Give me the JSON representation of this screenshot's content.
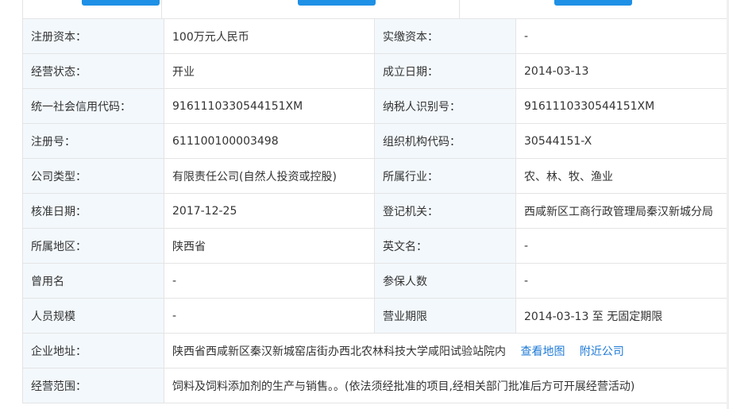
{
  "colors": {
    "label_bg": "#f3f8fc",
    "border": "#e4e4e4",
    "button": "#1e90e6",
    "link": "#1e7ad6"
  },
  "rows": [
    {
      "l1": "注册资本：",
      "v1": "100万元人民币",
      "l2": "实缴资本：",
      "v2": "-"
    },
    {
      "l1": "经营状态：",
      "v1": "开业",
      "l2": "成立日期：",
      "v2": "2014-03-13"
    },
    {
      "l1": "统一社会信用代码：",
      "v1": "9161110330544151XM",
      "l2": "纳税人识别号：",
      "v2": "9161110330544151XM"
    },
    {
      "l1": "注册号：",
      "v1": "611100100003498",
      "l2": "组织机构代码：",
      "v2": "30544151-X"
    },
    {
      "l1": "公司类型：",
      "v1": "有限责任公司(自然人投资或控股)",
      "l2": "所属行业：",
      "v2": "农、林、牧、渔业"
    },
    {
      "l1": "核准日期：",
      "v1": "2017-12-25",
      "l2": "登记机关：",
      "v2": "西咸新区工商行政管理局秦汉新城分局"
    },
    {
      "l1": "所属地区：",
      "v1": "陕西省",
      "l2": "英文名：",
      "v2": "-"
    },
    {
      "l1": "曾用名",
      "v1": "-",
      "l2": "参保人数",
      "v2": "-"
    },
    {
      "l1": "人员规模",
      "v1": "-",
      "l2": "营业期限",
      "v2": "2014-03-13 至 无固定期限"
    }
  ],
  "address": {
    "label": "企业地址：",
    "value": "陕西省西咸新区秦汉新城窑店街办西北农林科技大学咸阳试验站院内",
    "view_map": "查看地图",
    "nearby": "附近公司"
  },
  "scope": {
    "label": "经营范围：",
    "value": "饲料及饲料添加剂的生产与销售。。(依法须经批准的项目,经相关部门批准后方可开展经营活动)"
  }
}
